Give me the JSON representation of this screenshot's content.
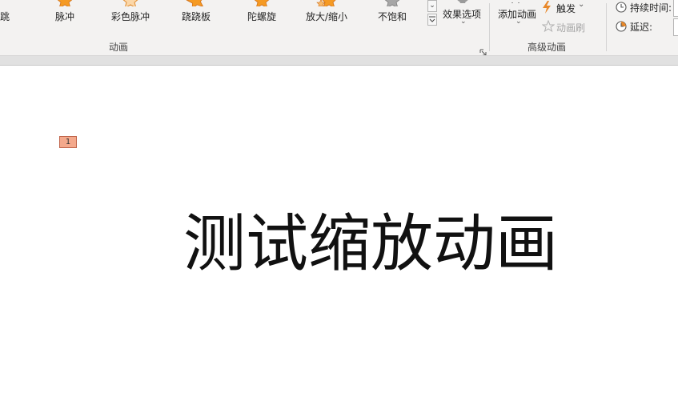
{
  "ribbon": {
    "gallery": [
      {
        "label": "跳",
        "icon": "bounce-star-icon"
      },
      {
        "label": "脉冲",
        "icon": "pulse-star-icon"
      },
      {
        "label": "彩色脉冲",
        "icon": "color-pulse-star-icon"
      },
      {
        "label": "跷跷板",
        "icon": "teeter-star-icon"
      },
      {
        "label": "陀螺旋",
        "icon": "spin-star-icon"
      },
      {
        "label": "放大/缩小",
        "icon": "grow-shrink-star-icon"
      },
      {
        "label": "不饱和",
        "icon": "desaturate-star-icon"
      }
    ],
    "effect_options_label": "效果选项",
    "animation_group_label": "动画",
    "add_animation_label": "添加动画",
    "trigger_label": "触发",
    "animation_painter_label": "动画刷",
    "advanced_group_label": "高级动画",
    "duration_label": "持续时间:",
    "delay_label": "延迟:",
    "colors": {
      "ribbon_bg": "#f3f2f1",
      "star_orange": "#f59a23",
      "star_gray": "#9e9e9e",
      "accent_orange": "#e8882a"
    }
  },
  "slide": {
    "animation_tag": "1",
    "title": "测试缩放动画"
  }
}
